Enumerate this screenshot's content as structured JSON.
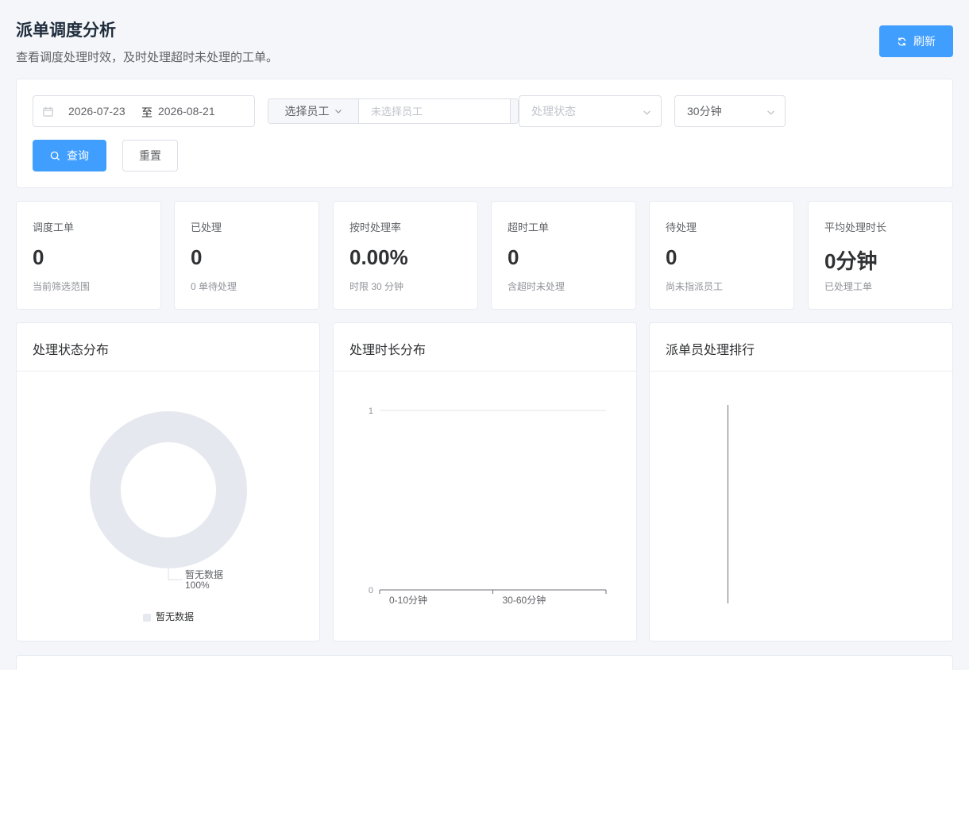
{
  "header": {
    "title": "派单调度分析",
    "subtitle": "查看调度处理时效，及时处理超时未处理的工单。",
    "refresh_label": "刷新"
  },
  "filters": {
    "date_start": "2026-07-23",
    "date_sep": "至",
    "date_end": "2026-08-21",
    "employee_button_label": "选择员工",
    "employee_placeholder": "未选择员工",
    "status_placeholder": "处理状态",
    "time_limit_value": "30分钟",
    "query_label": "查询",
    "reset_label": "重置"
  },
  "stats": [
    {
      "label": "调度工单",
      "value": "0",
      "note": "当前筛选范围"
    },
    {
      "label": "已处理",
      "value": "0",
      "note": "0 单待处理"
    },
    {
      "label": "按时处理率",
      "value": "0.00%",
      "note": "时限 30 分钟"
    },
    {
      "label": "超时工单",
      "value": "0",
      "note": "含超时未处理"
    },
    {
      "label": "待处理",
      "value": "0",
      "note": "尚未指派员工"
    },
    {
      "label": "平均处理时长",
      "value": "0分钟",
      "note": "已处理工单"
    }
  ],
  "charts": {
    "status": {
      "title": "处理状态分布"
    },
    "duration": {
      "title": "处理时长分布"
    },
    "ranking": {
      "title": "派单员处理排行"
    }
  },
  "chart_data": [
    {
      "type": "pie",
      "title": "处理状态分布",
      "slices": [
        {
          "label": "暂无数据",
          "value": 100,
          "percent": "100%",
          "color": "#e5e8ef"
        }
      ],
      "legend": [
        "暂无数据"
      ],
      "legend_position": "bottom"
    },
    {
      "type": "bar",
      "title": "处理时长分布",
      "categories": [
        "0-10分钟",
        "30-60分钟"
      ],
      "values": [
        0,
        0
      ],
      "ylim": [
        0,
        1
      ],
      "yticks": [
        "0",
        "1"
      ],
      "grid": true
    },
    {
      "type": "bar",
      "title": "派单员处理排行",
      "categories": [],
      "values": []
    }
  ],
  "colors": {
    "primary": "#409eff",
    "empty": "#e5e8ef"
  }
}
